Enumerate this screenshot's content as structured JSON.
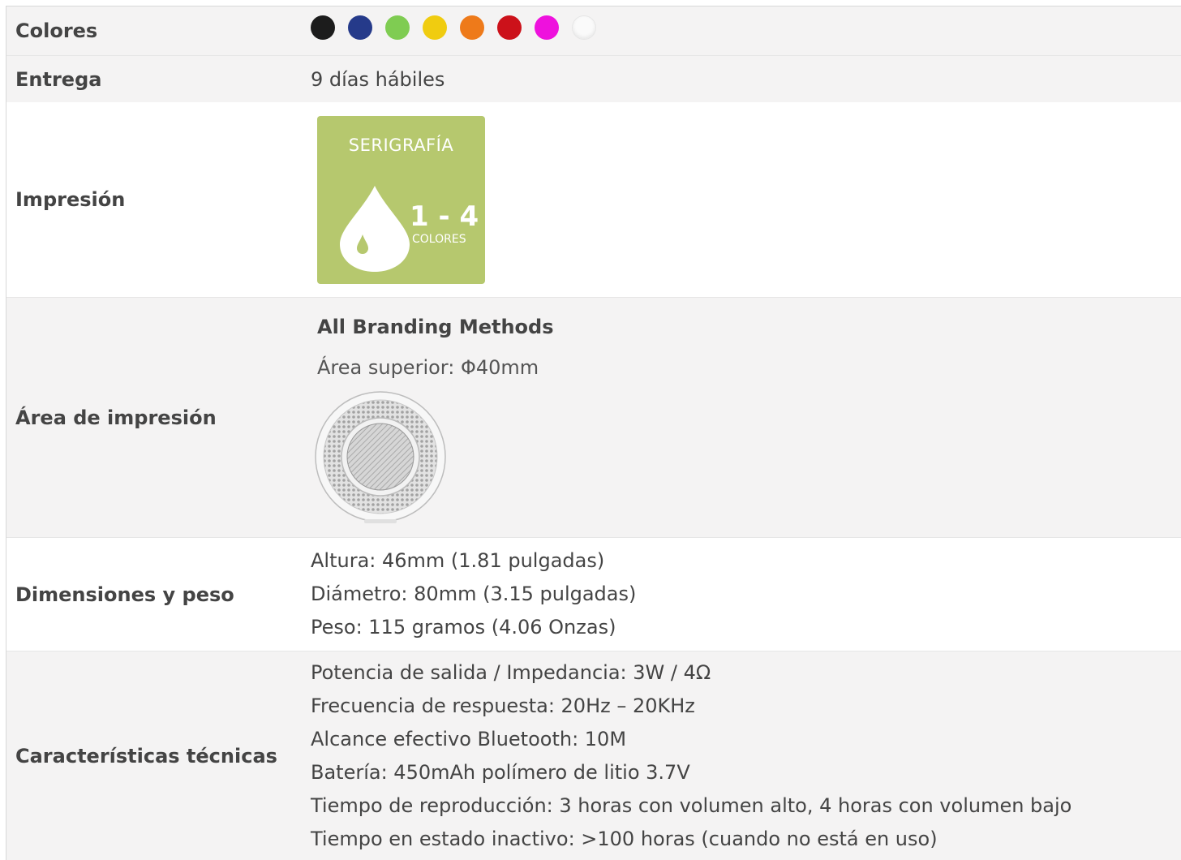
{
  "spec": {
    "colores": {
      "label": "Colores",
      "swatches": [
        {
          "name": "black",
          "color": "#1c1c1c"
        },
        {
          "name": "blue",
          "color": "#253a8a"
        },
        {
          "name": "light-green",
          "color": "#7fcc52"
        },
        {
          "name": "yellow",
          "color": "#f0cc10"
        },
        {
          "name": "orange",
          "color": "#ee7a1a"
        },
        {
          "name": "red",
          "color": "#cc111a"
        },
        {
          "name": "magenta",
          "color": "#ee11dd"
        },
        {
          "name": "white",
          "color": "#fafafa"
        }
      ]
    },
    "entrega": {
      "label": "Entrega",
      "value": "9 días hábiles"
    },
    "impresion": {
      "label": "Impresión",
      "badge_title": "SERIGRAFÍA",
      "badge_range": "1 - 4",
      "badge_unit": "COLORES",
      "badge_color": "#b6c86e"
    },
    "area": {
      "label": "Área de impresión",
      "method": "All Branding Methods",
      "top_area": "Área superior: Φ40mm"
    },
    "dimensiones": {
      "label": "Dimensiones y peso",
      "lines": [
        "Altura: 46mm (1.81 pulgadas)",
        "Diámetro: 80mm (3.15 pulgadas)",
        "Peso: 115 gramos (4.06 Onzas)"
      ]
    },
    "tecnicas": {
      "label": "Características técnicas",
      "lines": [
        "Potencia de salida / Impedancia: 3W / 4Ω",
        "Frecuencia de respuesta: 20Hz – 20KHz",
        "Alcance efectivo Bluetooth: 10M",
        "Batería: 450mAh polímero de litio 3.7V",
        "Tiempo de reproducción: 3 horas con volumen alto, 4 horas con volumen bajo",
        "Tiempo en estado inactivo: >100 horas (cuando no está en uso)"
      ]
    }
  }
}
